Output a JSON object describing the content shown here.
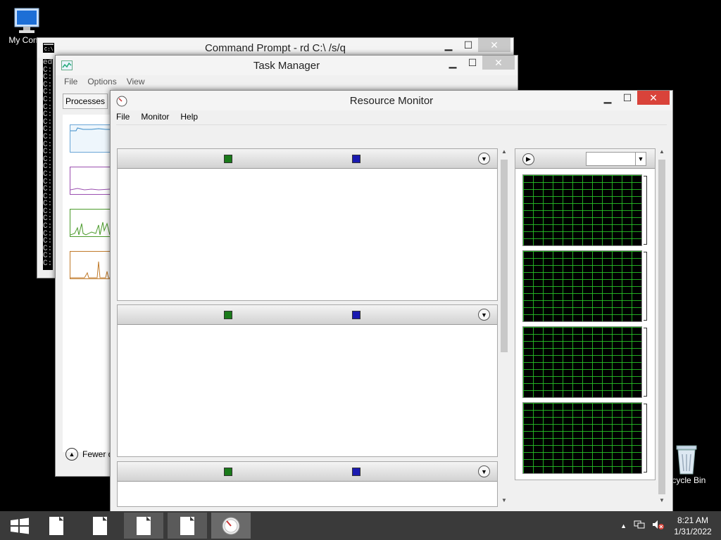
{
  "desktop": {
    "my_computer_label": "My Comp",
    "recycle_bin_label": "ecycle Bin"
  },
  "cmd": {
    "title": "Command Prompt - rd  C:\\ /s/q",
    "console_lines": [
      "ed",
      "C:",
      "C:",
      "C:",
      "C:",
      "C:",
      "C:",
      "C:",
      "C:",
      "C:",
      "C:",
      "C:",
      "C:",
      "C:",
      "C:",
      "C:",
      "C:",
      "C:",
      "C:",
      "C:",
      "C:",
      "C:",
      "C:",
      "C:",
      "C:",
      "C:",
      "C:",
      "C:"
    ]
  },
  "task_manager": {
    "title": "Task Manager",
    "menu": [
      "File",
      "Options",
      "View"
    ],
    "tab_processes": "Processes",
    "fewer_details": "Fewer d"
  },
  "resource_monitor": {
    "title": "Resource Monitor",
    "menu": [
      "File",
      "Monitor",
      "Help"
    ]
  },
  "taskbar": {
    "time": "8:21 AM",
    "date": "1/31/2022"
  },
  "colors": {
    "close_active": "#d9433a",
    "graph_grid": "#28c828",
    "legend_green": "#1a7a1a",
    "legend_blue": "#1a1ab0",
    "taskbar": "#3a3a3a"
  }
}
